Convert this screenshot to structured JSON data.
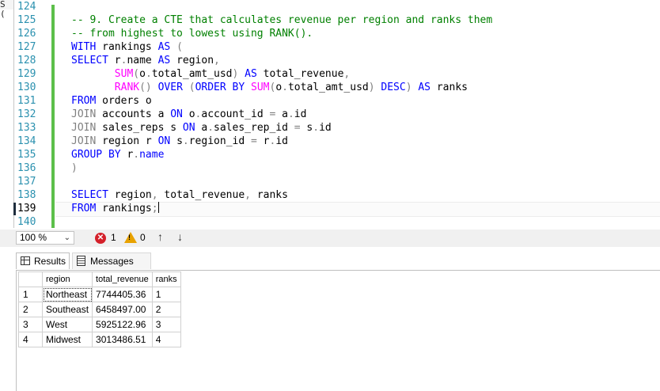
{
  "window": {
    "corner_fragment": "S ("
  },
  "editor": {
    "current_line": "139",
    "lines": [
      {
        "num": "124",
        "tokens": []
      },
      {
        "num": "125",
        "tokens": [
          {
            "t": "cm",
            "v": "-- 9. Create a CTE that calculates revenue per region and ranks them"
          }
        ]
      },
      {
        "num": "126",
        "tokens": [
          {
            "t": "cm",
            "v": "-- from highest to lowest using RANK()."
          }
        ]
      },
      {
        "num": "127",
        "tokens": [
          {
            "t": "kw",
            "v": "WITH"
          },
          {
            "t": "tx",
            "v": " rankings "
          },
          {
            "t": "kw",
            "v": "AS"
          },
          {
            "t": "tx",
            "v": " "
          },
          {
            "t": "op",
            "v": "("
          }
        ]
      },
      {
        "num": "128",
        "tokens": [
          {
            "t": "kw",
            "v": "SELECT"
          },
          {
            "t": "tx",
            "v": " r"
          },
          {
            "t": "op",
            "v": "."
          },
          {
            "t": "tx",
            "v": "name "
          },
          {
            "t": "kw",
            "v": "AS"
          },
          {
            "t": "tx",
            "v": " region"
          },
          {
            "t": "op",
            "v": ","
          }
        ]
      },
      {
        "num": "129",
        "tokens": [
          {
            "t": "tx",
            "v": "       "
          },
          {
            "t": "fn",
            "v": "SUM"
          },
          {
            "t": "op",
            "v": "("
          },
          {
            "t": "tx",
            "v": "o"
          },
          {
            "t": "op",
            "v": "."
          },
          {
            "t": "tx",
            "v": "total_amt_usd"
          },
          {
            "t": "op",
            "v": ")"
          },
          {
            "t": "tx",
            "v": " "
          },
          {
            "t": "kw",
            "v": "AS"
          },
          {
            "t": "tx",
            "v": " total_revenue"
          },
          {
            "t": "op",
            "v": ","
          }
        ]
      },
      {
        "num": "130",
        "tokens": [
          {
            "t": "tx",
            "v": "       "
          },
          {
            "t": "fn",
            "v": "RANK"
          },
          {
            "t": "op",
            "v": "()"
          },
          {
            "t": "tx",
            "v": " "
          },
          {
            "t": "kw",
            "v": "OVER"
          },
          {
            "t": "tx",
            "v": " "
          },
          {
            "t": "op",
            "v": "("
          },
          {
            "t": "kw",
            "v": "ORDER BY"
          },
          {
            "t": "tx",
            "v": " "
          },
          {
            "t": "fn",
            "v": "SUM"
          },
          {
            "t": "op",
            "v": "("
          },
          {
            "t": "tx",
            "v": "o"
          },
          {
            "t": "op",
            "v": "."
          },
          {
            "t": "tx",
            "v": "total_amt_usd"
          },
          {
            "t": "op",
            "v": ")"
          },
          {
            "t": "tx",
            "v": " "
          },
          {
            "t": "kw",
            "v": "DESC"
          },
          {
            "t": "op",
            "v": ")"
          },
          {
            "t": "tx",
            "v": " "
          },
          {
            "t": "kw",
            "v": "AS"
          },
          {
            "t": "tx",
            "v": " ranks"
          }
        ]
      },
      {
        "num": "131",
        "tokens": [
          {
            "t": "kw",
            "v": "FROM"
          },
          {
            "t": "tx",
            "v": " orders o"
          }
        ]
      },
      {
        "num": "132",
        "tokens": [
          {
            "t": "op",
            "v": "JOIN"
          },
          {
            "t": "tx",
            "v": " accounts a "
          },
          {
            "t": "kw",
            "v": "ON"
          },
          {
            "t": "tx",
            "v": " o"
          },
          {
            "t": "op",
            "v": "."
          },
          {
            "t": "tx",
            "v": "account_id "
          },
          {
            "t": "op",
            "v": "="
          },
          {
            "t": "tx",
            "v": " a"
          },
          {
            "t": "op",
            "v": "."
          },
          {
            "t": "tx",
            "v": "id"
          }
        ]
      },
      {
        "num": "133",
        "tokens": [
          {
            "t": "op",
            "v": "JOIN"
          },
          {
            "t": "tx",
            "v": " sales_reps s "
          },
          {
            "t": "kw",
            "v": "ON"
          },
          {
            "t": "tx",
            "v": " a"
          },
          {
            "t": "op",
            "v": "."
          },
          {
            "t": "tx",
            "v": "sales_rep_id "
          },
          {
            "t": "op",
            "v": "="
          },
          {
            "t": "tx",
            "v": " s"
          },
          {
            "t": "op",
            "v": "."
          },
          {
            "t": "tx",
            "v": "id"
          }
        ]
      },
      {
        "num": "134",
        "tokens": [
          {
            "t": "op",
            "v": "JOIN"
          },
          {
            "t": "tx",
            "v": " region r "
          },
          {
            "t": "kw",
            "v": "ON"
          },
          {
            "t": "tx",
            "v": " s"
          },
          {
            "t": "op",
            "v": "."
          },
          {
            "t": "tx",
            "v": "region_id "
          },
          {
            "t": "op",
            "v": "="
          },
          {
            "t": "tx",
            "v": " r"
          },
          {
            "t": "op",
            "v": "."
          },
          {
            "t": "tx",
            "v": "id"
          }
        ]
      },
      {
        "num": "135",
        "tokens": [
          {
            "t": "kw",
            "v": "GROUP BY"
          },
          {
            "t": "tx",
            "v": " r"
          },
          {
            "t": "op",
            "v": "."
          },
          {
            "t": "kw",
            "v": "name"
          }
        ]
      },
      {
        "num": "136",
        "tokens": [
          {
            "t": "op",
            "v": ")"
          }
        ]
      },
      {
        "num": "137",
        "tokens": []
      },
      {
        "num": "138",
        "tokens": [
          {
            "t": "kw",
            "v": "SELECT"
          },
          {
            "t": "tx",
            "v": " region"
          },
          {
            "t": "op",
            "v": ","
          },
          {
            "t": "tx",
            "v": " total_revenue"
          },
          {
            "t": "op",
            "v": ","
          },
          {
            "t": "tx",
            "v": " ranks"
          }
        ]
      },
      {
        "num": "139",
        "tokens": [
          {
            "t": "kw",
            "v": "FROM"
          },
          {
            "t": "tx",
            "v": " rankings"
          },
          {
            "t": "op",
            "v": ";"
          }
        ]
      },
      {
        "num": "140",
        "tokens": []
      }
    ]
  },
  "status": {
    "zoom": "100 %",
    "errors": "1",
    "warnings": "0"
  },
  "results": {
    "tabs": [
      {
        "label": "Results"
      },
      {
        "label": "Messages"
      }
    ],
    "columns": [
      "",
      "region",
      "total_revenue",
      "ranks"
    ],
    "rows": [
      [
        "1",
        "Northeast",
        "7744405.36",
        "1"
      ],
      [
        "2",
        "Southeast",
        "6458497.00",
        "2"
      ],
      [
        "3",
        "West",
        "5925122.96",
        "3"
      ],
      [
        "4",
        "Midwest",
        "3013486.51",
        "4"
      ]
    ]
  }
}
